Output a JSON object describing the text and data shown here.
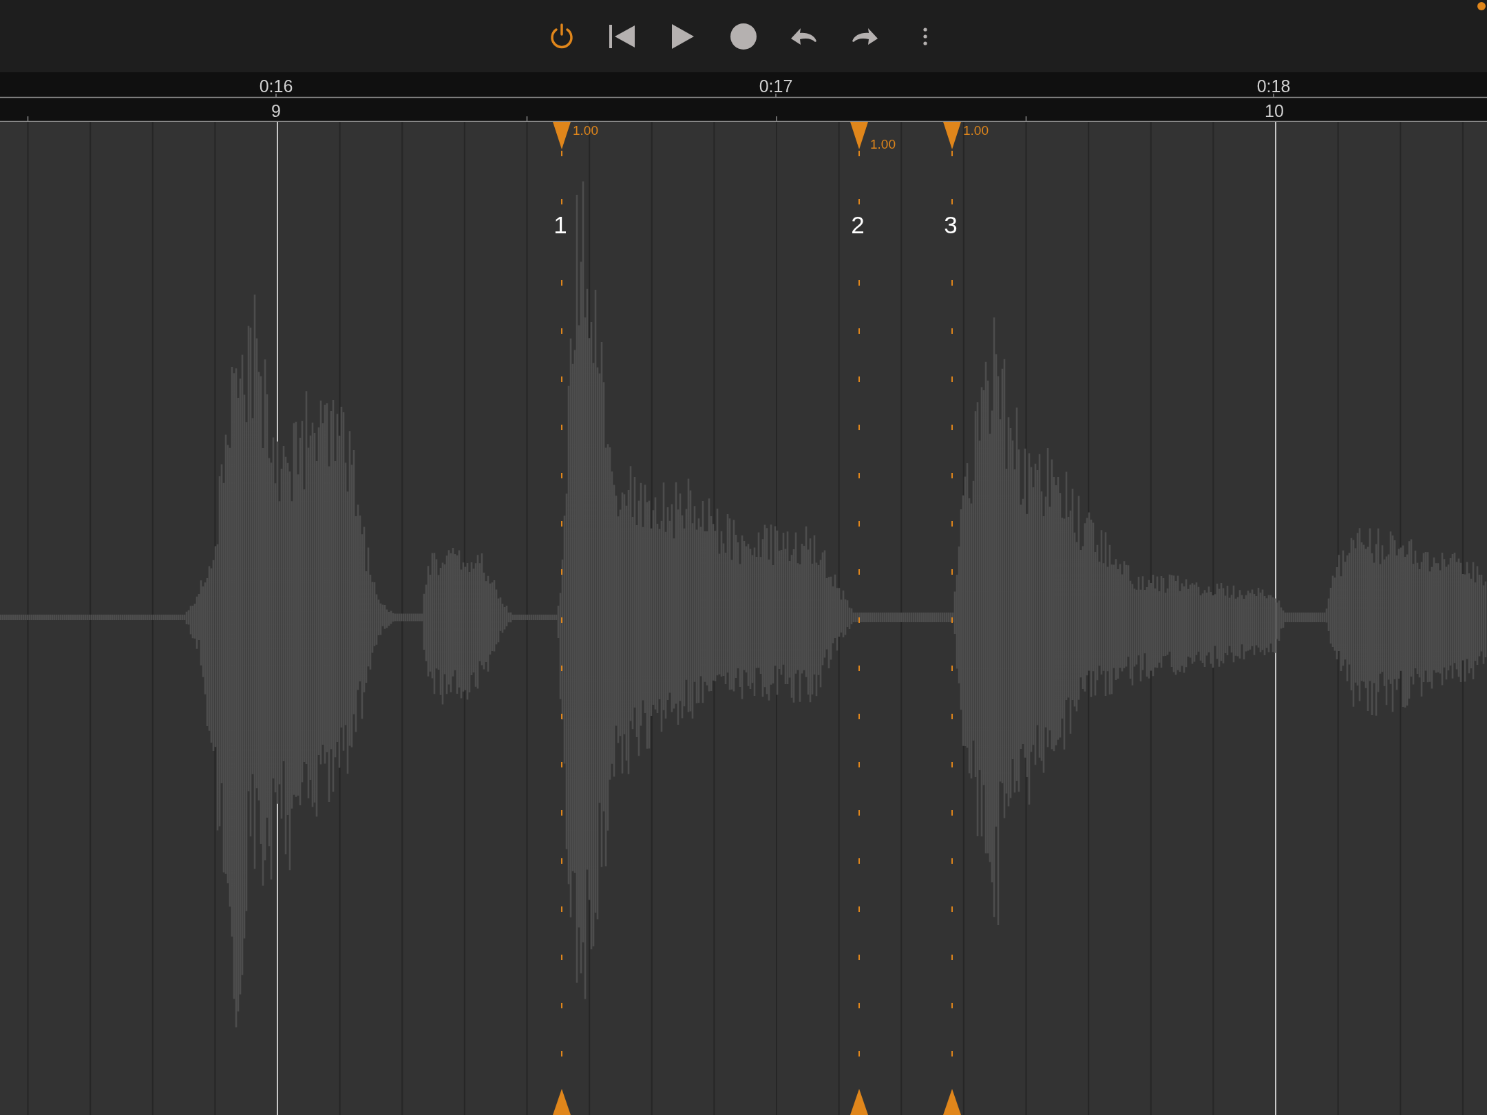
{
  "toolbar": {
    "buttons": [
      {
        "kind": "power",
        "on": true
      },
      {
        "kind": "skip-back"
      },
      {
        "kind": "play"
      },
      {
        "kind": "record"
      },
      {
        "kind": "undo"
      },
      {
        "kind": "redo"
      },
      {
        "kind": "more"
      }
    ]
  },
  "ruler": {
    "time_labels": [
      "0:16",
      "0:17",
      "0:18"
    ],
    "bar_numbers": [
      "9",
      "10"
    ]
  },
  "markers": [
    {
      "number": "1",
      "gain": "1.00"
    },
    {
      "number": "2",
      "gain": "1.00"
    },
    {
      "number": "3",
      "gain": "1.00"
    }
  ]
}
